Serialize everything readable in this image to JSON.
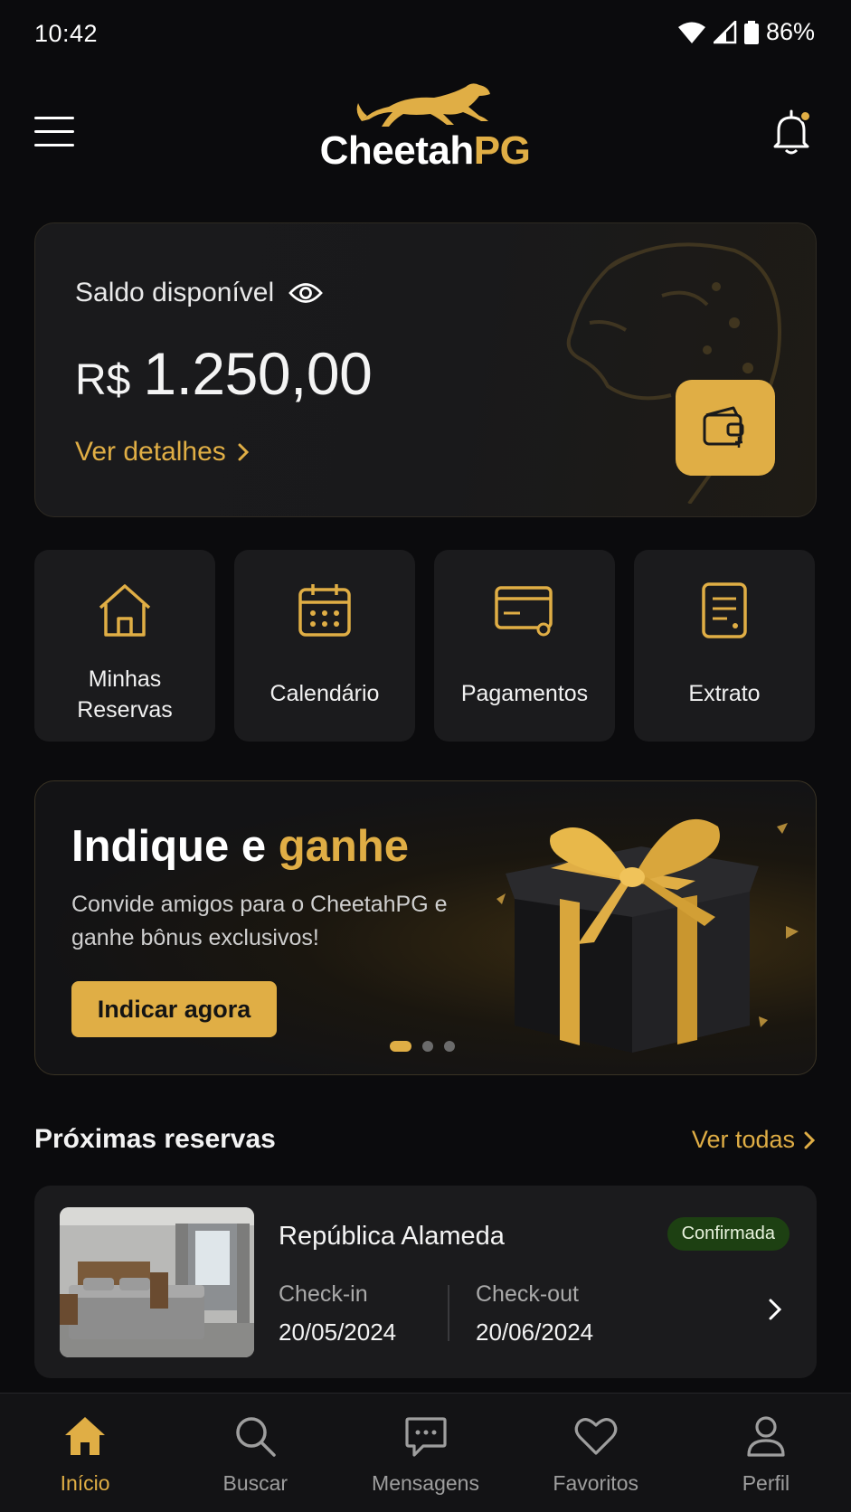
{
  "status": {
    "time": "10:42",
    "battery": "86%"
  },
  "header": {
    "logo_part1": "Cheetah",
    "logo_part2": "PG"
  },
  "balance": {
    "label": "Saldo disponível",
    "currency": "R$",
    "amount": "1.250,00",
    "details_link": "Ver detalhes"
  },
  "quick_actions": [
    {
      "label": "Minhas\nReservas",
      "icon": "house-icon"
    },
    {
      "label": "Calendário",
      "icon": "calendar-icon"
    },
    {
      "label": "Pagamentos",
      "icon": "card-icon"
    },
    {
      "label": "Extrato",
      "icon": "document-icon"
    }
  ],
  "promo": {
    "title_part1": "Indique e ",
    "title_part2": "ganhe",
    "description": "Convide amigos para o CheetahPG e ganhe bônus exclusivos!",
    "button": "Indicar agora",
    "slides_total": 3,
    "slide_active": 1
  },
  "upcoming": {
    "title": "Próximas reservas",
    "see_all": "Ver todas",
    "reservation": {
      "name": "República Alameda",
      "status": "Confirmada",
      "checkin_label": "Check-in",
      "checkin_date": "20/05/2024",
      "checkout_label": "Check-out",
      "checkout_date": "20/06/2024"
    }
  },
  "bottom_nav": [
    {
      "label": "Início",
      "icon": "home-icon",
      "active": true
    },
    {
      "label": "Buscar",
      "icon": "search-icon",
      "active": false
    },
    {
      "label": "Mensagens",
      "icon": "chat-icon",
      "active": false
    },
    {
      "label": "Favoritos",
      "icon": "heart-icon",
      "active": false
    },
    {
      "label": "Perfil",
      "icon": "user-icon",
      "active": false
    }
  ],
  "colors": {
    "accent": "#e0ae45",
    "background": "#0b0b0d",
    "card": "#1b1b1d",
    "badge": "#1d4012"
  }
}
